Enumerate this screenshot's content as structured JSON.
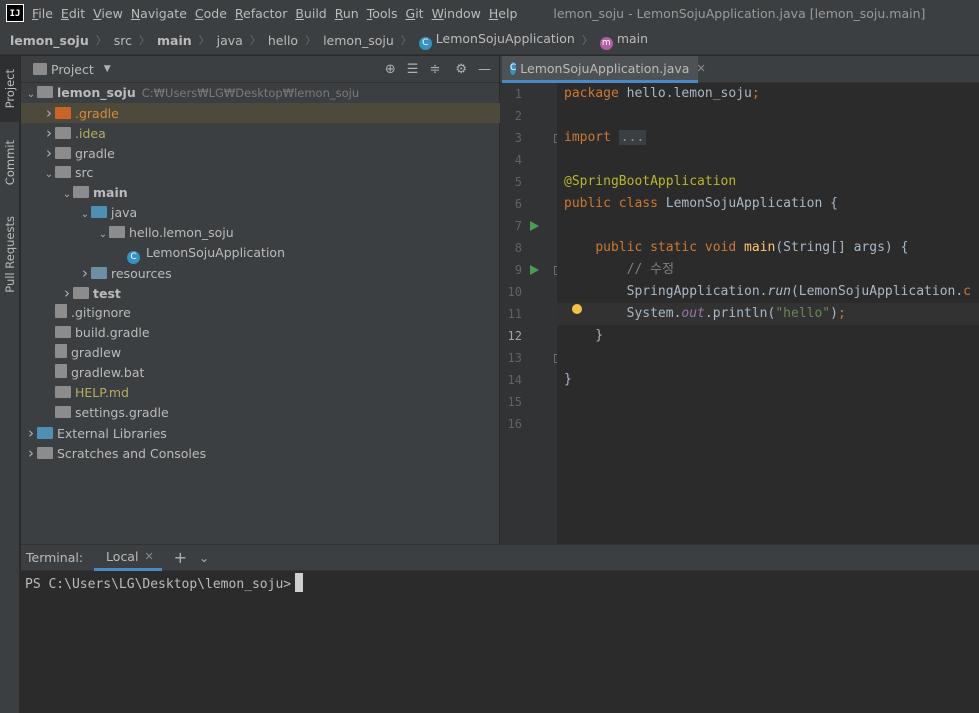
{
  "menubar": {
    "logo": "IJ",
    "items": [
      "File",
      "Edit",
      "View",
      "Navigate",
      "Code",
      "Refactor",
      "Build",
      "Run",
      "Tools",
      "Git",
      "Window",
      "Help"
    ],
    "mnemonics": [
      "F",
      "E",
      "V",
      "N",
      "C",
      "R",
      "B",
      "R",
      "T",
      "G",
      "W",
      "H"
    ],
    "window_title": "lemon_soju - LemonSojuApplication.java [lemon_soju.main]"
  },
  "breadcrumb": {
    "items": [
      "lemon_soju",
      "src",
      "main",
      "java",
      "hello",
      "lemon_soju",
      "LemonSojuApplication",
      "main"
    ]
  },
  "left_strip": {
    "tabs": [
      "Project",
      "Commit",
      "Pull Requests"
    ]
  },
  "project_panel": {
    "title": "Project",
    "dropdown_icon": "caret-down-icon",
    "tools": [
      "locate-icon",
      "expand-all-icon",
      "collapse-all-icon",
      "gear-icon",
      "minimize-icon"
    ],
    "root_path": "C:₩Users₩LG₩Desktop₩lemon_soju",
    "tree": [
      {
        "label": "lemon_soju",
        "depth": 0,
        "arrow": "open",
        "icon": "folder-gray",
        "bold": true
      },
      {
        "label": ".gradle",
        "depth": 1,
        "arrow": "closed",
        "icon": "folder-orange",
        "color": "orange",
        "selected": true
      },
      {
        "label": ".idea",
        "depth": 1,
        "arrow": "closed",
        "icon": "folder-gray",
        "color": "olive"
      },
      {
        "label": "gradle",
        "depth": 1,
        "arrow": "closed",
        "icon": "folder-gray"
      },
      {
        "label": "src",
        "depth": 1,
        "arrow": "open",
        "icon": "folder-gray"
      },
      {
        "label": "main",
        "depth": 2,
        "arrow": "open",
        "icon": "folder-gray",
        "bold": true
      },
      {
        "label": "java",
        "depth": 3,
        "arrow": "open",
        "icon": "folder-blue"
      },
      {
        "label": "hello.lemon_soju",
        "depth": 4,
        "arrow": "open",
        "icon": "package"
      },
      {
        "label": "LemonSojuApplication",
        "depth": 5,
        "arrow": "none",
        "icon": "class"
      },
      {
        "label": "resources",
        "depth": 3,
        "arrow": "closed",
        "icon": "folder-src"
      },
      {
        "label": "test",
        "depth": 2,
        "arrow": "closed",
        "icon": "folder-gray",
        "bold": true
      },
      {
        "label": ".gitignore",
        "depth": 1,
        "arrow": "none",
        "icon": "file"
      },
      {
        "label": "build.gradle",
        "depth": 1,
        "arrow": "none",
        "icon": "gradle"
      },
      {
        "label": "gradlew",
        "depth": 1,
        "arrow": "none",
        "icon": "file"
      },
      {
        "label": "gradlew.bat",
        "depth": 1,
        "arrow": "none",
        "icon": "file"
      },
      {
        "label": "HELP.md",
        "depth": 1,
        "arrow": "none",
        "icon": "md",
        "color": "olive"
      },
      {
        "label": "settings.gradle",
        "depth": 1,
        "arrow": "none",
        "icon": "gradle"
      },
      {
        "label": "External Libraries",
        "depth": 0,
        "arrow": "closed",
        "icon": "libraries"
      },
      {
        "label": "Scratches and Consoles",
        "depth": 0,
        "arrow": "closed",
        "icon": "scratches"
      }
    ]
  },
  "editor": {
    "tab_label": "LemonSojuApplication.java",
    "current_line": 12,
    "line_numbers": [
      "1",
      "2",
      "3",
      "4",
      "5",
      "6",
      "7",
      "8",
      "9",
      "10",
      "11",
      "12",
      "13",
      "14",
      "15",
      "16"
    ]
  },
  "terminal": {
    "label": "Terminal:",
    "tab": "Local",
    "prompt": "PS C:\\Users\\LG\\Desktop\\lemon_soju>"
  },
  "colors": {
    "accent": "#4a88c7",
    "run_gutter": "#499c54",
    "selection": "#4d4a3c"
  }
}
